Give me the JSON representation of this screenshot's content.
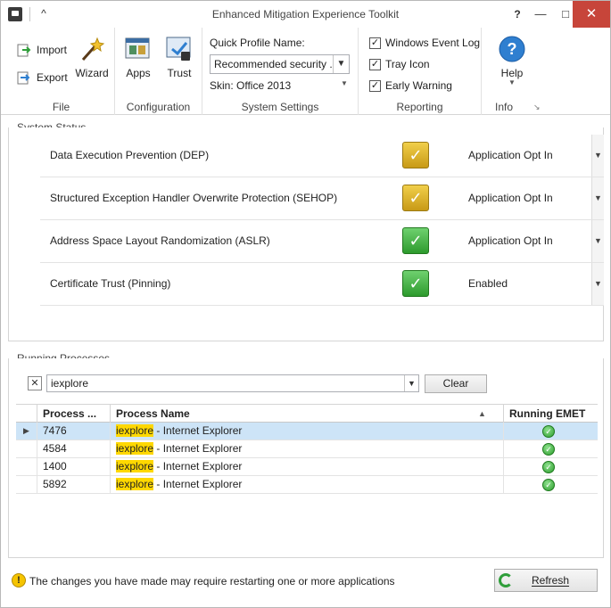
{
  "window": {
    "title": "Enhanced Mitigation Experience Toolkit",
    "controls": {
      "help": "?",
      "minimize": "—",
      "maximize": "□",
      "close": "✕"
    },
    "collapse_ribbon": "^"
  },
  "ribbon": {
    "file": {
      "label": "File",
      "import_label": "Import",
      "export_label": "Export",
      "wizard_label": "Wizard"
    },
    "configuration": {
      "label": "Configuration",
      "apps_label": "Apps",
      "trust_label": "Trust"
    },
    "system_settings": {
      "label": "System Settings",
      "quick_profile_label": "Quick Profile Name:",
      "quick_profile_value": "Recommended security ...",
      "skin_label": "Skin: Office 2013"
    },
    "reporting": {
      "label": "Reporting",
      "items": [
        {
          "label": "Windows Event Log",
          "checked": true
        },
        {
          "label": "Tray Icon",
          "checked": true
        },
        {
          "label": "Early Warning",
          "checked": true
        }
      ]
    },
    "info": {
      "label": "Info",
      "help_label": "Help"
    }
  },
  "system_status": {
    "title": "System Status",
    "rows": [
      {
        "name": "Data Execution Prevention (DEP)",
        "state": "warn",
        "value": "Application Opt In"
      },
      {
        "name": "Structured Exception Handler Overwrite Protection (SEHOP)",
        "state": "warn",
        "value": "Application Opt In"
      },
      {
        "name": "Address Space Layout Randomization (ASLR)",
        "state": "ok",
        "value": "Application Opt In"
      },
      {
        "name": "Certificate Trust (Pinning)",
        "state": "ok",
        "value": "Enabled"
      }
    ]
  },
  "running_processes": {
    "title": "Running Processes",
    "filter_value": "iexplore",
    "clear_label": "Clear",
    "columns": [
      "Process ...",
      "Process Name",
      "Running EMET"
    ],
    "rows": [
      {
        "pid": "7476",
        "name_highlight": "iexplore",
        "name_rest": " - Internet Explorer",
        "selected": true
      },
      {
        "pid": "4584",
        "name_highlight": "iexplore",
        "name_rest": " - Internet Explorer",
        "selected": false
      },
      {
        "pid": "1400",
        "name_highlight": "iexplore",
        "name_rest": " - Internet Explorer",
        "selected": false
      },
      {
        "pid": "5892",
        "name_highlight": "iexplore",
        "name_rest": " - Internet Explorer",
        "selected": false
      }
    ]
  },
  "footer": {
    "message": "The changes you have made may require restarting one or more applications",
    "refresh_label": "Refresh"
  },
  "colors": {
    "warn_check": "#d6a91f",
    "ok_check": "#3cab3c",
    "highlight": "#ffd800",
    "selected_row": "#cde4f7",
    "close_button": "#c7453a"
  }
}
